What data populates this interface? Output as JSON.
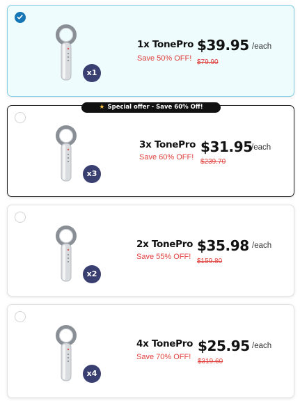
{
  "special_offer": {
    "icon": "star-icon",
    "label": "Special offer - Save 60% Off!"
  },
  "offers": [
    {
      "quantity_badge": "x1",
      "name": "1x TonePro",
      "save": "Save 50% OFF!",
      "price": "$39.95",
      "per": "/each",
      "original_price": "$79.90",
      "selected": true
    },
    {
      "quantity_badge": "x3",
      "name": "3x TonePro",
      "save": "Save 60% OFF!",
      "price": "$31.95",
      "per": "/each",
      "original_price": "$239.70",
      "selected": false
    },
    {
      "quantity_badge": "x2",
      "name": "2x TonePro",
      "save": "Save 55% OFF!",
      "price": "$35.98",
      "per": "/each",
      "original_price": "$159.80",
      "selected": false
    },
    {
      "quantity_badge": "x4",
      "name": "4x TonePro",
      "save": "Save 70% OFF!",
      "price": "$25.95",
      "per": "/each",
      "original_price": "$319.60",
      "selected": false
    }
  ],
  "colors": {
    "selected_background": "#eefcfe",
    "selected_border": "#7fcfe0",
    "radio_checked": "#1776b5",
    "badge": "#3a3f72",
    "discount_text": "#e0403c",
    "ribbon_background": "#111111"
  }
}
